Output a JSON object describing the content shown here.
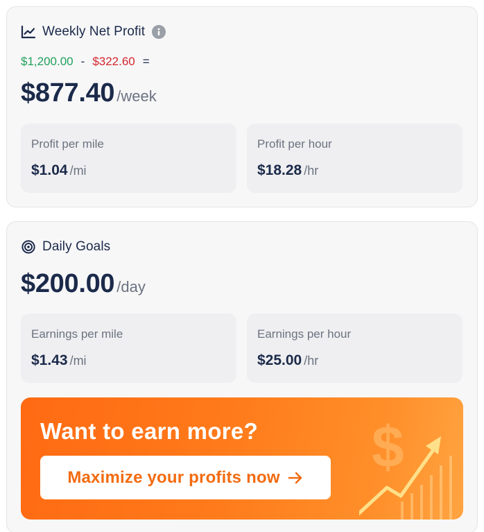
{
  "profit_card": {
    "title": "Weekly Net Profit",
    "title_icon": "line-chart-icon",
    "info_icon": "info-icon",
    "income": "$1,200.00",
    "minus": "-",
    "expenses": "$322.60",
    "equals": "=",
    "net_value": "$877.40",
    "net_unit": "/week",
    "stats": [
      {
        "label": "Profit per mile",
        "value": "$1.04",
        "unit": "/mi"
      },
      {
        "label": "Profit per hour",
        "value": "$18.28",
        "unit": "/hr"
      }
    ]
  },
  "goals_card": {
    "title": "Daily Goals",
    "title_icon": "target-icon",
    "goal_value": "$200.00",
    "goal_unit": "/day",
    "stats": [
      {
        "label": "Earnings per mile",
        "value": "$1.43",
        "unit": "/mi"
      },
      {
        "label": "Earnings per hour",
        "value": "$25.00",
        "unit": "/hr"
      }
    ]
  },
  "promo": {
    "title": "Want to earn more?",
    "button_label": "Maximize your profits now",
    "button_icon": "arrow-right-icon",
    "art_icon": "dollar-growth-icon"
  },
  "colors": {
    "income": "#22a05a",
    "expense": "#d3262d",
    "primary_text": "#1b2a4a",
    "promo_orange": "#ff6a13"
  }
}
